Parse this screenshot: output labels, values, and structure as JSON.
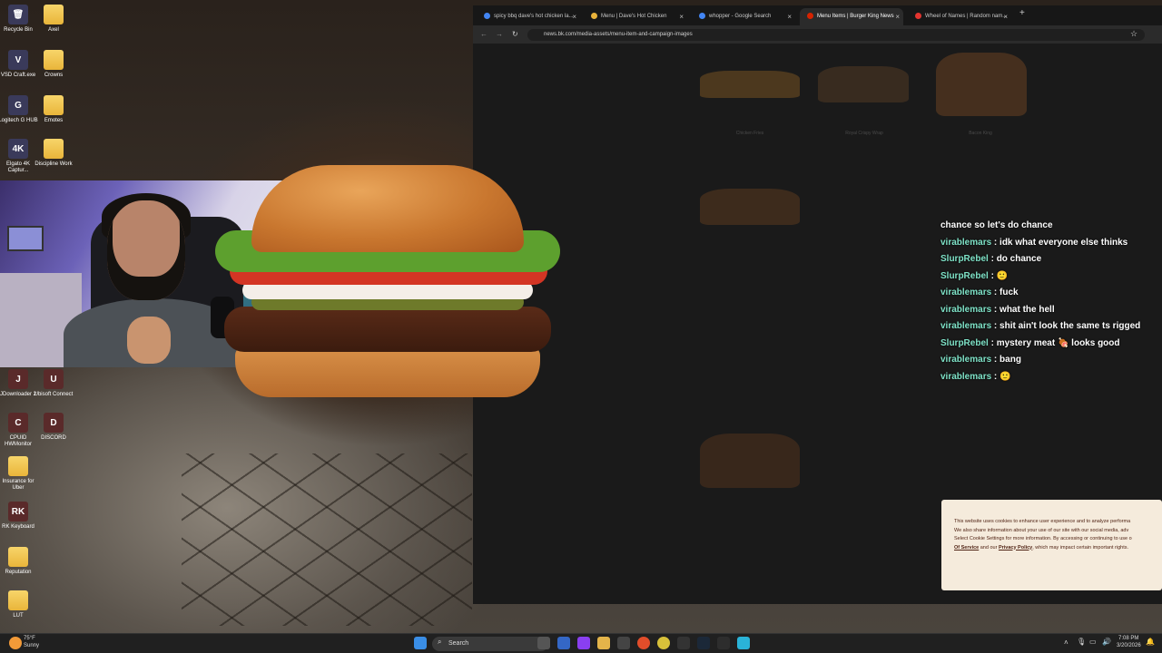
{
  "desktop": {
    "icons_top": [
      {
        "label": "Recycle Bin",
        "glyph": "🗑",
        "x": 0
      },
      {
        "label": "Axel",
        "glyph": "",
        "x": 1
      },
      {
        "label": "VSD Craft.exe",
        "glyph": "V",
        "x": 0
      },
      {
        "label": "Crowns",
        "glyph": "",
        "x": 1
      },
      {
        "label": "Logitech G HUB",
        "glyph": "G",
        "x": 0
      },
      {
        "label": "Emotes",
        "glyph": "",
        "x": 1
      },
      {
        "label": "Elgato 4K Captur...",
        "glyph": "4K",
        "x": 0
      },
      {
        "label": "Discipline Work",
        "glyph": "",
        "x": 1
      }
    ],
    "icons_bottom": [
      {
        "label": "JDownloader 2",
        "glyph": "J"
      },
      {
        "label": "Ubisoft Connect",
        "glyph": "U"
      },
      {
        "label": "CPUID HWMonitor",
        "glyph": "C"
      },
      {
        "label": "DISCORD",
        "glyph": "D"
      },
      {
        "label": "Insurance for Uber",
        "glyph": ""
      },
      {
        "label": "RK Keyboard",
        "glyph": "RK"
      },
      {
        "label": "Reputation",
        "glyph": ""
      },
      {
        "label": "LUT",
        "glyph": ""
      }
    ]
  },
  "browser": {
    "tabs": [
      {
        "label": "spicy bbq dave's hot chicken la...",
        "fav": "#4285f4"
      },
      {
        "label": "Menu | Dave's Hot Chicken",
        "fav": "#e8b23a"
      },
      {
        "label": "whopper - Google Search",
        "fav": "#4285f4"
      },
      {
        "label": "Menu Items | Burger King News",
        "fav": "#d62300"
      },
      {
        "label": "Wheel of Names | Random nam...",
        "fav": "#e3342f"
      }
    ],
    "url": "news.bk.com/media-assets/menu-item-and-campaign-images",
    "ghost_labels": [
      "Chicken Fries",
      "Royal Crispy Wrap",
      "Bacon King"
    ]
  },
  "chat": {
    "messages": [
      {
        "user": "",
        "text": "chance so let's do chance"
      },
      {
        "user": "virablemars",
        "text": "idk what everyone else thinks"
      },
      {
        "user": "SlurpRebel",
        "text": "do chance"
      },
      {
        "user": "SlurpRebel",
        "text": "🙂"
      },
      {
        "user": "virablemars",
        "text": "fuck"
      },
      {
        "user": "virablemars",
        "text": "what the hell"
      },
      {
        "user": "virablemars",
        "text": "shit ain't look the same ts rigged"
      },
      {
        "user": "SlurpRebel",
        "text": "mystery meat 🍖 looks good"
      },
      {
        "user": "virablemars",
        "text": "bang"
      },
      {
        "user": "virablemars",
        "text": "🙂"
      }
    ]
  },
  "cookie": {
    "line1": "This website uses cookies to enhance user experience and to analyze performa",
    "line2": "We also share information about your use of our site with our social media, adv",
    "line3": "Select Cookie Settings for more information. By accessing or continuing to use o",
    "terms": "Of Service",
    "mid": " and our ",
    "privacy": "Privacy Policy",
    "tail": ", which may impact certain important rights."
  },
  "taskbar": {
    "weather_temp": "75°F",
    "weather_cond": "Sunny",
    "search_label": "Search",
    "time": "7:08 PM",
    "date": "3/20/2026"
  }
}
